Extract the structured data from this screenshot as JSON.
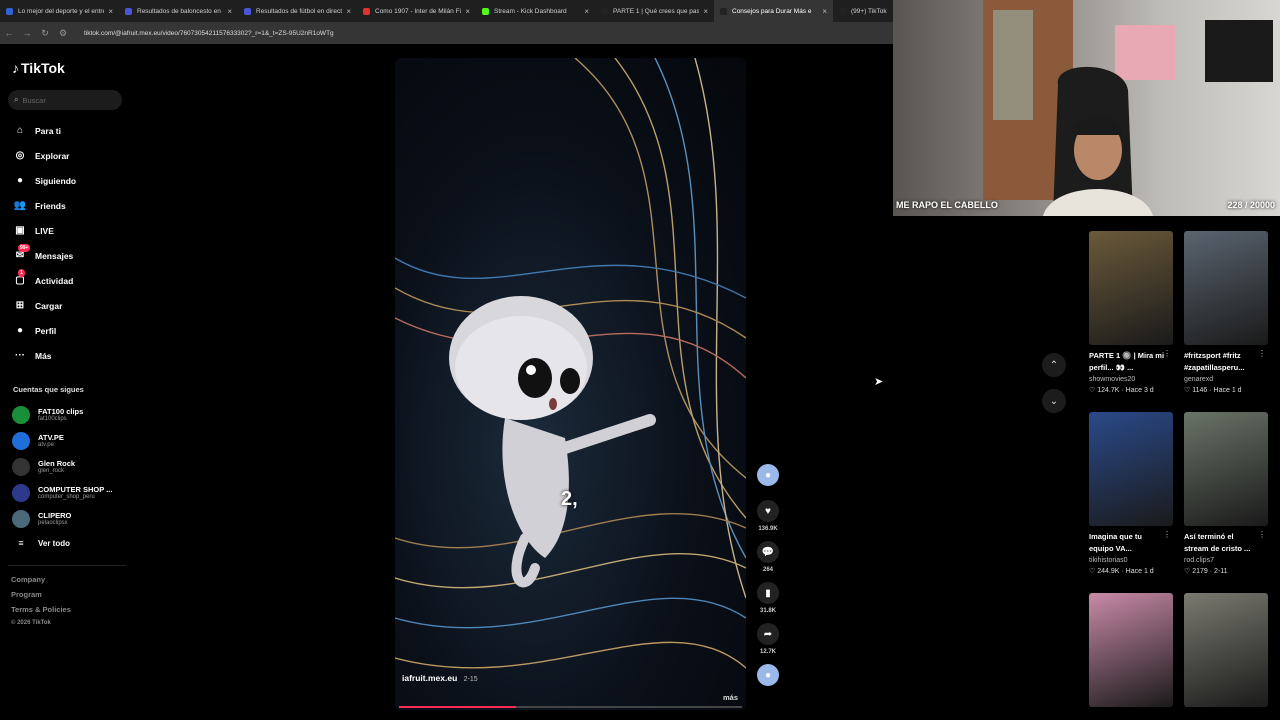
{
  "browser": {
    "tabs": [
      {
        "title": "Lo mejor del deporte y el entre",
        "color": "#2e63d6"
      },
      {
        "title": "Resultados de baloncesto en di",
        "color": "#4a56d8"
      },
      {
        "title": "Resultados de fútbol en directo",
        "color": "#4a56d8"
      },
      {
        "title": "Como 1907 - Inter de Milán Fü",
        "color": "#e03030"
      },
      {
        "title": "Stream - Kick Dashboard",
        "color": "#53fc18"
      },
      {
        "title": "PARTE 1 | Qué crees que pasar",
        "color": "#222222"
      },
      {
        "title": "Consejos para Durar Más e",
        "color": "#222222"
      },
      {
        "title": "(99+) TikTok",
        "color": "#222222"
      }
    ],
    "url": "tiktok.com/@iafruit.mex.eu/video/7607305421157633302?_r=1&_t=ZS-95U2nR1oWTg"
  },
  "sidebar": {
    "logo": "TikTok",
    "search_placeholder": "Buscar",
    "nav": [
      {
        "label": "Para ti",
        "icon": "home-icon",
        "glyph": "⌂"
      },
      {
        "label": "Explorar",
        "icon": "compass-icon",
        "glyph": "◎"
      },
      {
        "label": "Siguiendo",
        "icon": "following-avatar-icon",
        "glyph": "●"
      },
      {
        "label": "Friends",
        "icon": "friends-icon",
        "glyph": "👥"
      },
      {
        "label": "LIVE",
        "icon": "live-icon",
        "glyph": "▣"
      },
      {
        "label": "Mensajes",
        "icon": "messages-icon",
        "glyph": "✉",
        "badge": "99+"
      },
      {
        "label": "Actividad",
        "icon": "activity-icon",
        "glyph": "▢",
        "badge": "1"
      },
      {
        "label": "Cargar",
        "icon": "upload-icon",
        "glyph": "⊞"
      },
      {
        "label": "Perfil",
        "icon": "profile-avatar-icon",
        "glyph": "●"
      },
      {
        "label": "Más",
        "icon": "more-icon",
        "glyph": "···"
      }
    ],
    "following_title": "Cuentas que sigues",
    "following": [
      {
        "name": "FAT100 clips",
        "handle": "fat100clips",
        "color": "#1a8f3a"
      },
      {
        "name": "ATV.PE",
        "handle": "atv.pe",
        "color": "#1e6fd9"
      },
      {
        "name": "Glen Rock",
        "handle": "glen_rock",
        "color": "#333333"
      },
      {
        "name": "COMPUTER SHOP ...",
        "handle": "computer_shop_peru",
        "color": "#2d3a8c"
      },
      {
        "name": "CLIPERO",
        "handle": "pelaoclipsx",
        "color": "#4a6a7a"
      }
    ],
    "see_all": "Ver todo",
    "footer": [
      "Company",
      "Program",
      "Terms & Policies"
    ],
    "copyright": "© 2026 TikTok"
  },
  "video": {
    "creator": "iafruit.mex.eu",
    "date": "2-15",
    "subtitle": "2,",
    "more": "más",
    "progress": 0.34
  },
  "actions": [
    {
      "icon": "heart-icon",
      "glyph": "♥",
      "count": "136.9K"
    },
    {
      "icon": "comment-icon",
      "glyph": "💬",
      "count": "264"
    },
    {
      "icon": "bookmark-icon",
      "glyph": "▮",
      "count": "31.8K"
    },
    {
      "icon": "share-icon",
      "glyph": "➦",
      "count": "12.7K"
    }
  ],
  "webcam": {
    "label": "ME RAPO EL CABELLO",
    "count": "228 / 20000"
  },
  "feed": [
    {
      "title": "PARTE 1 🔘 | Mira mi perfil... 👀 ...",
      "author": "showmovies20",
      "likes": "124.7K",
      "time": "Hace 3 d",
      "color": "#6b5a3a"
    },
    {
      "title": "#fritzsport #fritz #zapatillasperu...",
      "author": "genarexd",
      "likes": "1146",
      "time": "Hace 1 d",
      "color": "#5a6470"
    },
    {
      "title": "Imagina que tu equipo VA...",
      "author": "tikihistorias0",
      "likes": "244.9K",
      "time": "Hace 1 d",
      "color": "#2a4a8a"
    },
    {
      "title": "Así terminó el stream de cristo ...",
      "author": "rod.clips7",
      "likes": "2179",
      "time": "2-11",
      "color": "#6a7468"
    },
    {
      "title": "",
      "author": "",
      "likes": "",
      "time": "",
      "color": "#c88aa8"
    },
    {
      "title": "",
      "author": "",
      "likes": "",
      "time": "",
      "color": "#7a7a70"
    }
  ]
}
